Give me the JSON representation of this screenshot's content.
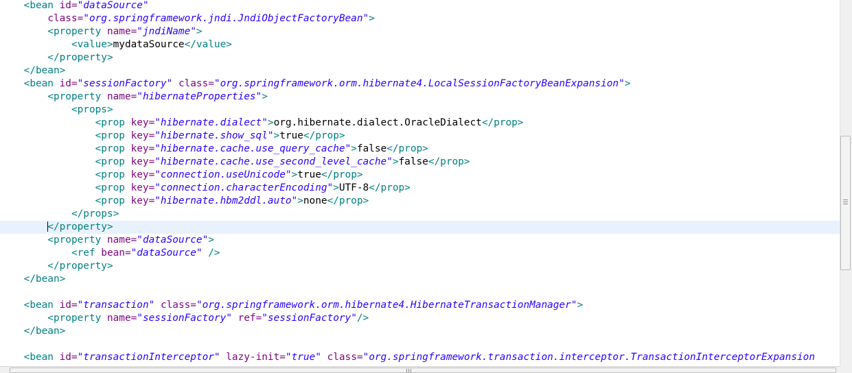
{
  "editor": {
    "current_line_index": 17,
    "lines": [
      [
        {
          "t": "    <bean ",
          "c": "t"
        },
        {
          "t": "id=",
          "c": "a"
        },
        {
          "t": "\"dataSource\"",
          "c": "v"
        }
      ],
      [
        {
          "t": "        ",
          "c": "p"
        },
        {
          "t": "class=",
          "c": "a"
        },
        {
          "t": "\"org.springframework.jndi.JndiObjectFactoryBean\"",
          "c": "v"
        },
        {
          "t": ">",
          "c": "t"
        }
      ],
      [
        {
          "t": "        <property ",
          "c": "t"
        },
        {
          "t": "name=",
          "c": "a"
        },
        {
          "t": "\"jndiName\"",
          "c": "v"
        },
        {
          "t": ">",
          "c": "t"
        }
      ],
      [
        {
          "t": "            <value>",
          "c": "t"
        },
        {
          "t": "mydataSource",
          "c": "p"
        },
        {
          "t": "</value>",
          "c": "t"
        }
      ],
      [
        {
          "t": "        </property>",
          "c": "t"
        }
      ],
      [
        {
          "t": "    </bean>",
          "c": "t"
        }
      ],
      [
        {
          "t": "    <bean ",
          "c": "t"
        },
        {
          "t": "id=",
          "c": "a"
        },
        {
          "t": "\"sessionFactory\"",
          "c": "v"
        },
        {
          "t": " ",
          "c": "p"
        },
        {
          "t": "class=",
          "c": "a"
        },
        {
          "t": "\"org.springframework.orm.hibernate4.LocalSessionFactoryBeanExpansion\"",
          "c": "v"
        },
        {
          "t": ">",
          "c": "t"
        }
      ],
      [
        {
          "t": "        <property ",
          "c": "t"
        },
        {
          "t": "name=",
          "c": "a"
        },
        {
          "t": "\"hibernateProperties\"",
          "c": "v"
        },
        {
          "t": ">",
          "c": "t"
        }
      ],
      [
        {
          "t": "            <props>",
          "c": "t"
        }
      ],
      [
        {
          "t": "                <prop ",
          "c": "t"
        },
        {
          "t": "key=",
          "c": "a"
        },
        {
          "t": "\"hibernate.dialect\"",
          "c": "v"
        },
        {
          "t": ">",
          "c": "t"
        },
        {
          "t": "org.hibernate.dialect.OracleDialect",
          "c": "p"
        },
        {
          "t": "</prop>",
          "c": "t"
        }
      ],
      [
        {
          "t": "                <prop ",
          "c": "t"
        },
        {
          "t": "key=",
          "c": "a"
        },
        {
          "t": "\"hibernate.show_sql\"",
          "c": "v"
        },
        {
          "t": ">",
          "c": "t"
        },
        {
          "t": "true",
          "c": "p"
        },
        {
          "t": "</prop>",
          "c": "t"
        }
      ],
      [
        {
          "t": "                <prop ",
          "c": "t"
        },
        {
          "t": "key=",
          "c": "a"
        },
        {
          "t": "\"hibernate.cache.use_query_cache\"",
          "c": "v"
        },
        {
          "t": ">",
          "c": "t"
        },
        {
          "t": "false",
          "c": "p"
        },
        {
          "t": "</prop>",
          "c": "t"
        }
      ],
      [
        {
          "t": "                <prop ",
          "c": "t"
        },
        {
          "t": "key=",
          "c": "a"
        },
        {
          "t": "\"hibernate.cache.use_second_level_cache\"",
          "c": "v"
        },
        {
          "t": ">",
          "c": "t"
        },
        {
          "t": "false",
          "c": "p"
        },
        {
          "t": "</prop>",
          "c": "t"
        }
      ],
      [
        {
          "t": "                <prop ",
          "c": "t"
        },
        {
          "t": "key=",
          "c": "a"
        },
        {
          "t": "\"connection.useUnicode\"",
          "c": "v"
        },
        {
          "t": ">",
          "c": "t"
        },
        {
          "t": "true",
          "c": "p"
        },
        {
          "t": "</prop>",
          "c": "t"
        }
      ],
      [
        {
          "t": "                <prop ",
          "c": "t"
        },
        {
          "t": "key=",
          "c": "a"
        },
        {
          "t": "\"connection.characterEncoding\"",
          "c": "v"
        },
        {
          "t": ">",
          "c": "t"
        },
        {
          "t": "UTF-8",
          "c": "p"
        },
        {
          "t": "</prop>",
          "c": "t"
        }
      ],
      [
        {
          "t": "                <prop ",
          "c": "t"
        },
        {
          "t": "key=",
          "c": "a"
        },
        {
          "t": "\"hibernate.hbm2ddl.auto\"",
          "c": "v"
        },
        {
          "t": ">",
          "c": "t"
        },
        {
          "t": "none",
          "c": "p"
        },
        {
          "t": "</prop>",
          "c": "t"
        }
      ],
      [
        {
          "t": "            </props>",
          "c": "t"
        }
      ],
      [
        {
          "t": "        ",
          "c": "p"
        },
        {
          "t": "CARET",
          "c": "caret"
        },
        {
          "t": "</property>",
          "c": "t"
        }
      ],
      [
        {
          "t": "        <property ",
          "c": "t"
        },
        {
          "t": "name=",
          "c": "a"
        },
        {
          "t": "\"dataSource\"",
          "c": "v"
        },
        {
          "t": ">",
          "c": "t"
        }
      ],
      [
        {
          "t": "            <ref ",
          "c": "t"
        },
        {
          "t": "bean=",
          "c": "a"
        },
        {
          "t": "\"dataSource\"",
          "c": "v"
        },
        {
          "t": " />",
          "c": "t"
        }
      ],
      [
        {
          "t": "        </property>",
          "c": "t"
        }
      ],
      [
        {
          "t": "    </bean>",
          "c": "t"
        }
      ],
      [
        {
          "t": "",
          "c": "p"
        }
      ],
      [
        {
          "t": "    <bean ",
          "c": "t"
        },
        {
          "t": "id=",
          "c": "a"
        },
        {
          "t": "\"transaction\"",
          "c": "v"
        },
        {
          "t": " ",
          "c": "p"
        },
        {
          "t": "class=",
          "c": "a"
        },
        {
          "t": "\"org.springframework.orm.hibernate4.HibernateTransactionManager\"",
          "c": "v"
        },
        {
          "t": ">",
          "c": "t"
        }
      ],
      [
        {
          "t": "        <property ",
          "c": "t"
        },
        {
          "t": "name=",
          "c": "a"
        },
        {
          "t": "\"sessionFactory\"",
          "c": "v"
        },
        {
          "t": " ",
          "c": "p"
        },
        {
          "t": "ref=",
          "c": "a"
        },
        {
          "t": "\"sessionFactory\"",
          "c": "v"
        },
        {
          "t": "/>",
          "c": "t"
        }
      ],
      [
        {
          "t": "    </bean>",
          "c": "t"
        }
      ],
      [
        {
          "t": "",
          "c": "p"
        }
      ],
      [
        {
          "t": "    <bean ",
          "c": "t"
        },
        {
          "t": "id=",
          "c": "a"
        },
        {
          "t": "\"transactionInterceptor\"",
          "c": "v"
        },
        {
          "t": " ",
          "c": "p"
        },
        {
          "t": "lazy-init=",
          "c": "a"
        },
        {
          "t": "\"true\"",
          "c": "v"
        },
        {
          "t": " ",
          "c": "p"
        },
        {
          "t": "class=",
          "c": "a"
        },
        {
          "t": "\"org.springframework.transaction.interceptor.TransactionInterceptorExpansion",
          "c": "v"
        }
      ]
    ]
  },
  "colors": {
    "tag": "#008080",
    "attribute": "#7f007f",
    "value": "#2a00ff",
    "text": "#000000",
    "current_line_highlight": "#e8f2fe"
  }
}
